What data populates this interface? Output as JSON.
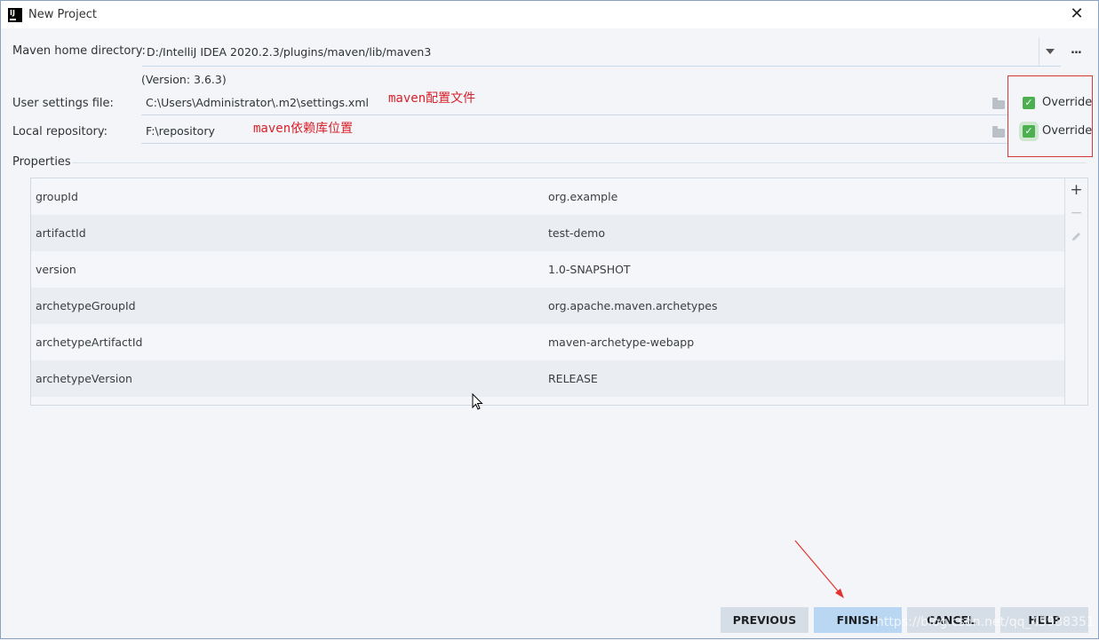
{
  "window": {
    "title": "New Project"
  },
  "maven": {
    "home_label": "Maven home directory:",
    "home_value": "D:/IntelliJ IDEA 2020.2.3/plugins/maven/lib/maven3",
    "version_text": "(Version: 3.6.3)",
    "ellipsis": "...",
    "settings_label": "User settings file:",
    "settings_value": "C:\\Users\\Administrator\\.m2\\settings.xml",
    "repo_label": "Local repository:",
    "repo_value": "F:\\repository",
    "override_label": "Override",
    "settings_override_checked": true,
    "repo_override_checked": true
  },
  "annotations": {
    "settings_note": "maven配置文件",
    "repo_note": "maven依赖库位置",
    "color": "#d9202a"
  },
  "properties": {
    "title": "Properties",
    "rows": [
      {
        "key": "groupId",
        "value": "org.example"
      },
      {
        "key": "artifactId",
        "value": "test-demo"
      },
      {
        "key": "version",
        "value": "1.0-SNAPSHOT"
      },
      {
        "key": "archetypeGroupId",
        "value": "org.apache.maven.archetypes"
      },
      {
        "key": "archetypeArtifactId",
        "value": "maven-archetype-webapp"
      },
      {
        "key": "archetypeVersion",
        "value": "RELEASE"
      }
    ],
    "toolbar": [
      "add-icon",
      "remove-icon",
      "edit-icon"
    ]
  },
  "buttons": {
    "previous": "PREVIOUS",
    "finish": "FINISH",
    "cancel": "CANCEL",
    "help": "HELP"
  },
  "watermark": "https://blog.csdn.net/qq_45938351",
  "colors": {
    "accent": "#b9d6f2",
    "checkbox": "#4caf50",
    "annotation": "#d9202a"
  }
}
